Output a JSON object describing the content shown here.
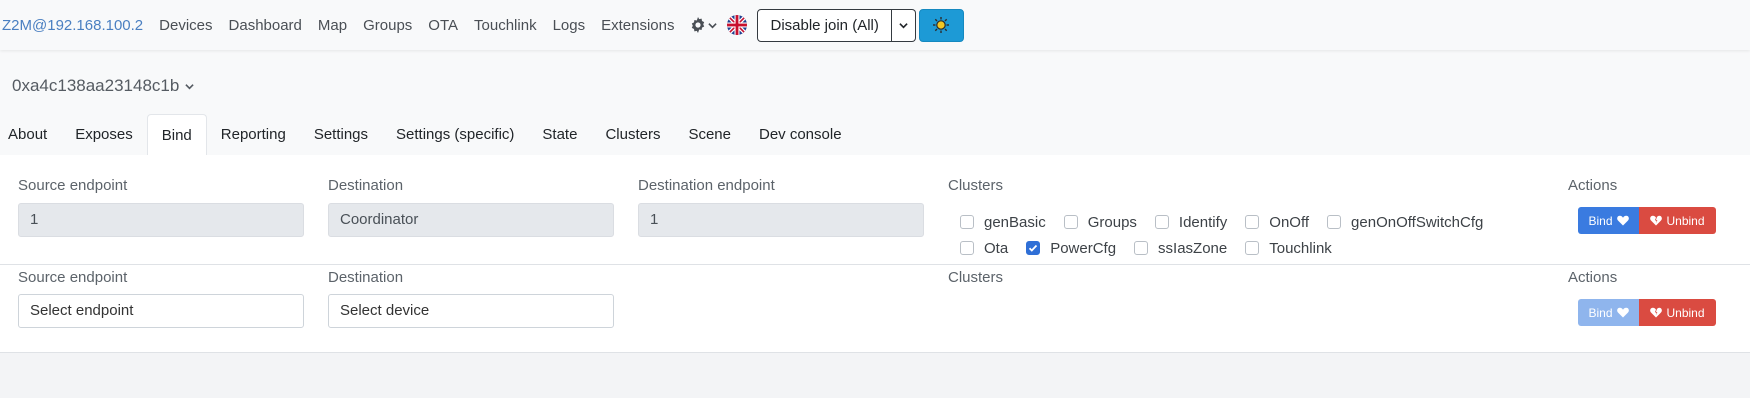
{
  "navbar": {
    "brand": "Z2M@192.168.100.2",
    "links": [
      "Devices",
      "Dashboard",
      "Map",
      "Groups",
      "OTA",
      "Touchlink",
      "Logs",
      "Extensions"
    ],
    "join_label": "Disable join (All)"
  },
  "device": {
    "title": "0xa4c138aa23148c1b"
  },
  "tabs": [
    "About",
    "Exposes",
    "Bind",
    "Reporting",
    "Settings",
    "Settings (specific)",
    "State",
    "Clusters",
    "Scene",
    "Dev console"
  ],
  "active_tab": "Bind",
  "bindings": [
    {
      "source_label": "Source endpoint",
      "source_value": "1",
      "dest_label": "Destination",
      "dest_value": "Coordinator",
      "dest_ep_label": "Destination endpoint",
      "dest_ep_value": "1",
      "clusters_label": "Clusters",
      "actions_label": "Actions",
      "clusters_row1": [
        {
          "name": "genBasic",
          "checked": false
        },
        {
          "name": "Groups",
          "checked": false
        },
        {
          "name": "Identify",
          "checked": false
        },
        {
          "name": "OnOff",
          "checked": false
        },
        {
          "name": "genOnOffSwitchCfg",
          "checked": false
        }
      ],
      "clusters_row2": [
        {
          "name": "Ota",
          "checked": false
        },
        {
          "name": "PowerCfg",
          "checked": true
        },
        {
          "name": "ssIasZone",
          "checked": false
        },
        {
          "name": "Touchlink",
          "checked": false
        }
      ],
      "bind_label": "Bind",
      "unbind_label": "Unbind"
    },
    {
      "source_label": "Source endpoint",
      "source_placeholder": "Select endpoint",
      "dest_label": "Destination",
      "dest_placeholder": "Select device",
      "clusters_label": "Clusters",
      "actions_label": "Actions",
      "bind_label": "Bind",
      "unbind_label": "Unbind"
    }
  ],
  "colors": {
    "brand": "#4a7fc1",
    "bind": "#3a7be0",
    "unbind": "#da4b41",
    "theme_button": "#1d9ad6"
  }
}
